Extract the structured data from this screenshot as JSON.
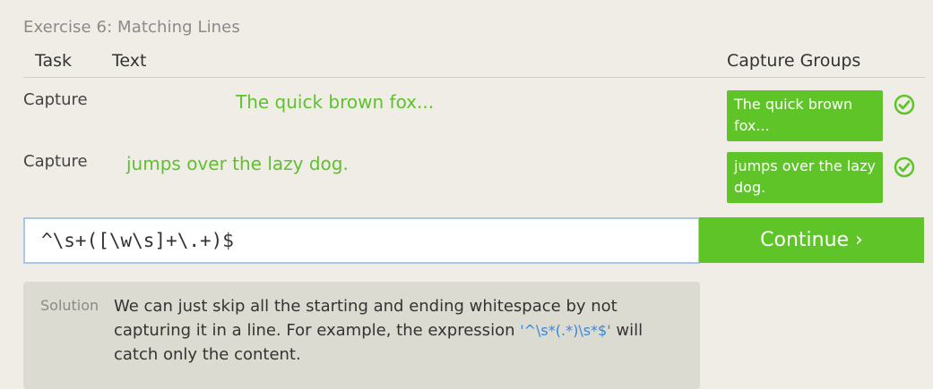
{
  "exercise": {
    "title": "Exercise 6: Matching Lines"
  },
  "headers": {
    "task": "Task",
    "text": "Text",
    "capture_groups": "Capture Groups"
  },
  "rows": [
    {
      "task": "Capture",
      "text": "The quick brown fox...",
      "capture_line1": "The quick brown",
      "capture_line2": "fox...",
      "status_icon": "check-circle-icon"
    },
    {
      "task": "Capture",
      "text": "jumps over the lazy dog.",
      "capture_line1": "jumps over the lazy",
      "capture_line2": "dog.",
      "status_icon": "check-circle-icon"
    }
  ],
  "input": {
    "value": "^\\s+([\\w\\s]+\\.+)$"
  },
  "continue": {
    "label": "Continue ›"
  },
  "solution": {
    "label": "Solution",
    "text_before": "We can just skip all the starting and ending whitespace by not capturing it in a line. For example, the expression ",
    "code": "'^\\s*(.*)\\s*$'",
    "text_after": " will catch only the content."
  },
  "colors": {
    "accent": "#5ec428",
    "background": "#efede6",
    "code": "#3a86d9"
  }
}
